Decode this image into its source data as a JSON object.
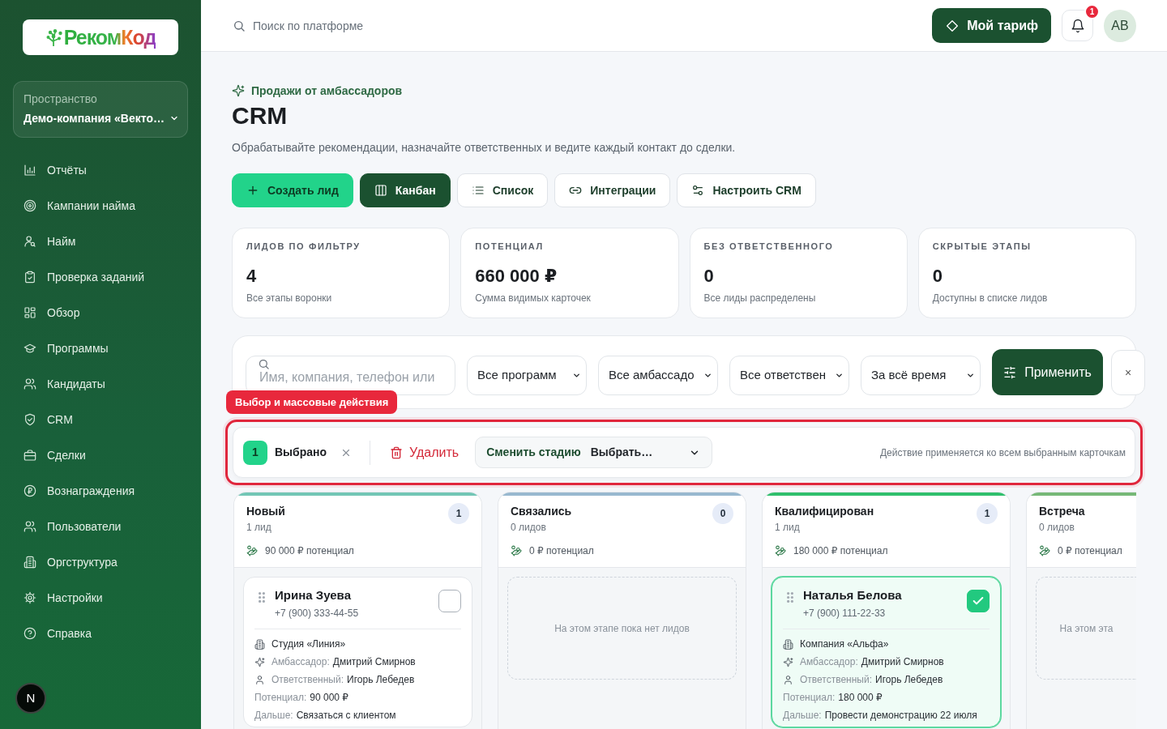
{
  "sidebar": {
    "logo": "РекомКод",
    "workspace": {
      "label": "Пространство",
      "name": "Демо-компания «Векто…"
    },
    "items": [
      {
        "label": "Отчёты",
        "selected": false
      },
      {
        "label": "Кампании найма",
        "selected": false
      },
      {
        "label": "Найм",
        "selected": false
      },
      {
        "label": "Проверка заданий",
        "selected": false
      },
      {
        "label": "Обзор",
        "selected": false
      },
      {
        "label": "Программы",
        "selected": false
      },
      {
        "label": "Кандидаты",
        "selected": false
      },
      {
        "label": "CRM",
        "selected": false
      },
      {
        "label": "Сделки",
        "selected": false
      },
      {
        "label": "Вознаграждения",
        "selected": false
      },
      {
        "label": "Пользователи",
        "selected": false
      },
      {
        "label": "Оргструктура",
        "selected": false
      },
      {
        "label": "Настройки",
        "selected": false
      },
      {
        "label": "Справка",
        "selected": false
      }
    ],
    "dev_badge": "N"
  },
  "header": {
    "search": {
      "placeholder": "Поиск по платформе"
    },
    "plan_button": "Мой тариф",
    "notifications": {
      "badge": "1"
    },
    "avatar": "AB"
  },
  "page": {
    "eyebrow": "Продажи от амбассадоров",
    "title": "CRM",
    "description": "Обрабатывайте рекомендации, назначайте ответственных и ведите каждый контакт до сделки."
  },
  "toolbar": {
    "create": "Создать лид",
    "views": [
      {
        "label": "Канбан",
        "selected": true
      },
      {
        "label": "Список",
        "selected": false
      }
    ],
    "integrations": "Интеграции",
    "configure": "Настроить CRM"
  },
  "stats": [
    {
      "label": "ЛИДОВ ПО ФИЛЬТРУ",
      "value": "4",
      "note": "Все этапы воронки"
    },
    {
      "label": "ПОТЕНЦИАЛ",
      "value": "660 000 ₽",
      "note": "Сумма видимых карточек"
    },
    {
      "label": "БЕЗ ОТВЕТСТВЕННОГО",
      "value": "0",
      "note": "Все лиды распределены"
    },
    {
      "label": "СКРЫТЫЕ ЭТАПЫ",
      "value": "0",
      "note": "Доступны в списке лидов"
    }
  ],
  "filters": {
    "search": {
      "placeholder": "Имя, компания, телефон или"
    },
    "selects": [
      {
        "value": "Все программ"
      },
      {
        "value": "Все амбассадо"
      },
      {
        "value": "Все ответствен"
      },
      {
        "value": "За всё время"
      }
    ],
    "apply": "Применить",
    "reset": "×"
  },
  "annotation": {
    "label": "Выбор и массовые действия"
  },
  "bulk_bar": {
    "count": "1",
    "selected_label": "Выбрано",
    "delete": "Удалить",
    "stage": {
      "label": "Сменить стадию",
      "value": "Выбрать…"
    },
    "hint": "Действие применяется ко всем выбранным карточкам"
  },
  "columns": [
    {
      "title": "Новый",
      "count": "1",
      "leads": "1 лид",
      "potential": "90 000 ₽ потенциал",
      "color": "#72c6b5",
      "cards": [
        {
          "name": "Ирина Зуева",
          "phone": "+7 (900) 333-44-55",
          "checked": false,
          "company": "Студия «Линия»",
          "ambassador": {
            "label": "Амбассадор:",
            "value": "Дмитрий Смирнов"
          },
          "responsible": {
            "label": "Ответственный:",
            "value": "Игорь Лебедев"
          },
          "potential": {
            "label": "Потенциал:",
            "value": "90 000 ₽"
          },
          "next": {
            "label": "Дальше:",
            "value": "Связаться с клиентом"
          }
        }
      ]
    },
    {
      "title": "Связались",
      "count": "0",
      "leads": "0 лидов",
      "potential": "0 ₽ потенциал",
      "color": "#98b8cf",
      "empty": "На этом этапе пока нет лидов"
    },
    {
      "title": "Квалифицирован",
      "count": "1",
      "leads": "1 лид",
      "potential": "180 000 ₽ потенциал",
      "color": "#2fbf6c",
      "cards": [
        {
          "name": "Наталья Белова",
          "phone": "+7 (900) 111-22-33",
          "checked": true,
          "company": "Компания «Альфа»",
          "ambassador": {
            "label": "Амбассадор:",
            "value": "Дмитрий Смирнов"
          },
          "responsible": {
            "label": "Ответственный:",
            "value": "Игорь Лебедев"
          },
          "potential": {
            "label": "Потенциал:",
            "value": "180 000 ₽"
          },
          "next": {
            "label": "Дальше:",
            "value": "Провести демонстрацию 22 июля"
          }
        }
      ]
    },
    {
      "title": "Встреча",
      "leads": "0 лидов",
      "potential": "0 ₽ потенциал",
      "color": "#76b877",
      "empty": "На этом эта"
    }
  ]
}
